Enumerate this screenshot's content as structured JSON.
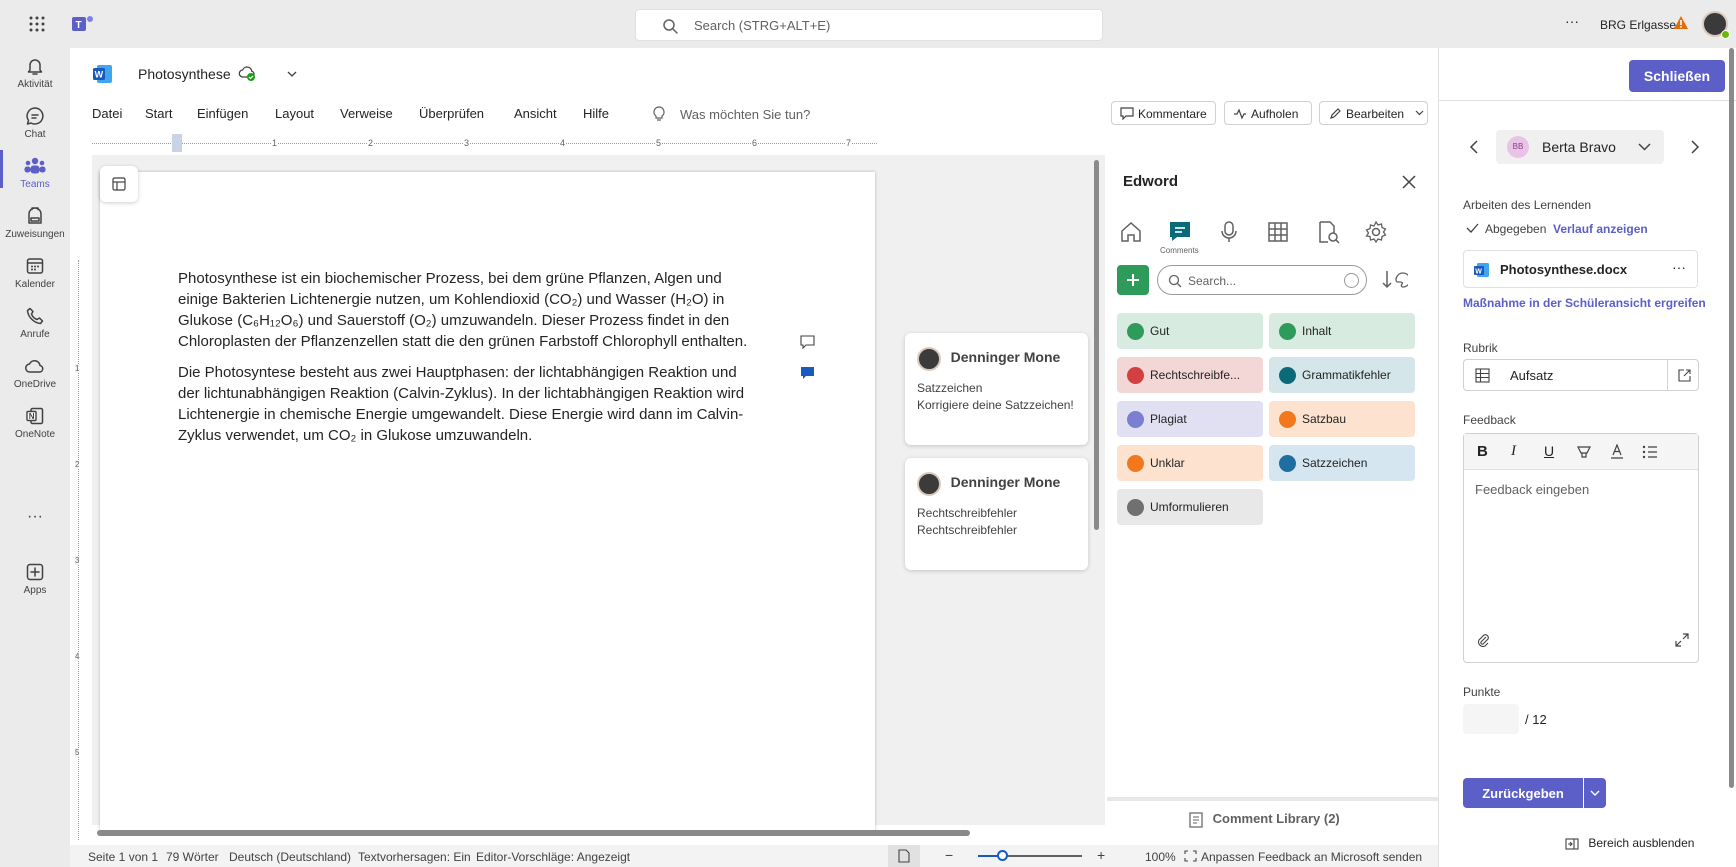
{
  "topbar": {
    "search_placeholder": "Search (STRG+ALT+E)",
    "org": "BRG Erlgasse",
    "more": "···"
  },
  "rail": [
    {
      "label": "Aktivität",
      "icon": "bell-icon"
    },
    {
      "label": "Chat",
      "icon": "chat-icon"
    },
    {
      "label": "Teams",
      "icon": "teams-icon"
    },
    {
      "label": "Zuweisungen",
      "icon": "backpack-icon"
    },
    {
      "label": "Kalender",
      "icon": "calendar-icon"
    },
    {
      "label": "Anrufe",
      "icon": "phone-icon"
    },
    {
      "label": "OneDrive",
      "icon": "cloud-icon"
    },
    {
      "label": "OneNote",
      "icon": "onenote-icon"
    },
    {
      "label": "···",
      "icon": "more-icon"
    },
    {
      "label": "Apps",
      "icon": "plus-icon"
    }
  ],
  "doc": {
    "title": "Photosynthese",
    "menus": [
      "Datei",
      "Start",
      "Einfügen",
      "Layout",
      "Verweise",
      "Überprüfen",
      "Ansicht",
      "Hilfe"
    ],
    "tell_me": "Was möchten Sie tun?",
    "btn_comments": "Kommentare",
    "btn_catchup": "Aufholen",
    "btn_edit": "Bearbeiten",
    "ruler": [
      "1",
      "2",
      "3",
      "4",
      "5",
      "6",
      "7"
    ],
    "vruler": [
      "1",
      "2",
      "3",
      "4",
      "5"
    ]
  },
  "paragraphs": {
    "p1": [
      "Photosynthese ist ein biochemischer Prozess, bei dem grüne Pflanzen, Algen und",
      "einige Bakterien Lichtenergie nutzen, um Kohlendioxid (CO₂) und Wasser (H₂O) in",
      "Glukose (C₆H₁₂O₆) und Sauerstoff (O₂) umzuwandeln. Dieser Prozess findet in den",
      "Chloroplasten der Pflanzenzellen statt die den grünen Farbstoff Chlorophyll enthalten."
    ],
    "p2": [
      "Die Photosyntese besteht aus zwei Hauptphasen: der lichtabhängigen Reaktion und",
      "der lichtunabhängigen Reaktion (Calvin-Zyklus). In der lichtabhängigen Reaktion wird",
      "Lichtenergie in chemische Energie umgewandelt. Diese Energie wird dann im Calvin-",
      "Zyklus verwendet, um CO₂ in Glukose umzuwandeln."
    ]
  },
  "comments": [
    {
      "author": "Denninger Mone",
      "l1": "Satzzeichen",
      "l2": "Korrigiere deine Satzzeichen!"
    },
    {
      "author": "Denninger Mone",
      "l1": "Rechtschreibfehler",
      "l2": "Rechtschreibfehler"
    }
  ],
  "edword": {
    "title": "Edword",
    "tab_label": "Comments",
    "search": "Search...",
    "library": "Comment Library (2)",
    "tags": [
      {
        "label": "Gut",
        "bg": "#d7ebe0",
        "dot": "#2e9b5a"
      },
      {
        "label": "Inhalt",
        "bg": "#d7ebe0",
        "dot": "#2e9b5a"
      },
      {
        "label": "Rechtschreibfe...",
        "bg": "#f3d7d7",
        "dot": "#d24040"
      },
      {
        "label": "Grammatikfehler",
        "bg": "#d4e6ea",
        "dot": "#0b6a7a"
      },
      {
        "label": "Plagiat",
        "bg": "#e0e0f2",
        "dot": "#7b7fd2"
      },
      {
        "label": "Satzbau",
        "bg": "#fde3cf",
        "dot": "#f2781b"
      },
      {
        "label": "Unklar",
        "bg": "#fde3cf",
        "dot": "#f2781b"
      },
      {
        "label": "Satzzeichen",
        "bg": "#d6e6f0",
        "dot": "#1e6f9f"
      },
      {
        "label": "Umformulieren",
        "bg": "#e8e8e8",
        "dot": "#707070"
      }
    ]
  },
  "right": {
    "close": "Schließen",
    "student": "Berta Bravo",
    "initials": "BB",
    "work_label": "Arbeiten des Lernenden",
    "submitted": "Abgegeben",
    "history": "Verlauf anzeigen",
    "file": "Photosynthese.docx",
    "action": "Maßnahme in der Schüleransicht ergreifen",
    "rubric_label": "Rubrik",
    "rubric": "Aufsatz",
    "feedback_label": "Feedback",
    "feedback_ph": "Feedback eingeben",
    "points_label": "Punkte",
    "points_max": "/ 12",
    "return": "Zurückgeben",
    "hide": "Bereich ausblenden"
  },
  "status": {
    "page": "Seite 1 von 1",
    "words": "79 Wörter",
    "lang": "Deutsch (Deutschland)",
    "predict": "Textvorhersagen: Ein",
    "editor": "Editor-Vorschläge: Angezeigt",
    "zoom": "100%",
    "fit": "Anpassen",
    "feedback": "Feedback an Microsoft senden"
  }
}
